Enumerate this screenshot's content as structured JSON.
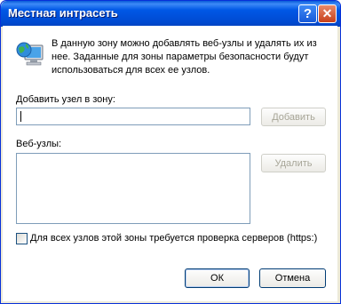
{
  "window": {
    "title": "Местная интрасеть"
  },
  "titlebar": {
    "help_label": "?",
    "close_label": "✕"
  },
  "info": {
    "text": "В данную зону можно добавлять веб-узлы и удалять их из нее. Заданные для зоны параметры безопасности будут использоваться для всех ее узлов."
  },
  "add_site": {
    "label": "Добавить узел  в зону:",
    "value": "",
    "button_label": "Добавить"
  },
  "sites": {
    "label": "Веб-узлы:",
    "items": [],
    "remove_label": "Удалить"
  },
  "https_check": {
    "label": "Для всех узлов этой зоны требуется проверка серверов (https:)",
    "checked": false
  },
  "footer": {
    "ok_label": "ОК",
    "cancel_label": "Отмена"
  },
  "colors": {
    "titlebar": "#0058e6",
    "dialog_bg": "#ece9d8",
    "field_border": "#7f9db9"
  },
  "icons": {
    "zone": "globe-computer-icon"
  }
}
